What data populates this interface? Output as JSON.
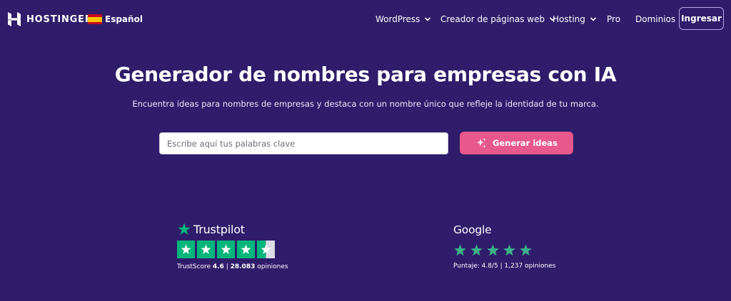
{
  "header": {
    "brand": "HOSTINGER",
    "language": "Español",
    "menu": [
      {
        "label": "WordPress",
        "has_dropdown": true
      },
      {
        "label": "Creador de páginas web",
        "has_dropdown": true
      },
      {
        "label": "Hosting",
        "has_dropdown": true
      },
      {
        "label": "Pro",
        "has_dropdown": false
      },
      {
        "label": "Dominios",
        "has_dropdown": false
      }
    ],
    "login_label": "Ingresar"
  },
  "hero": {
    "title": "Generador de nombres para empresas con IA",
    "subtitle": "Encuentra ideas para nombres de empresas y destaca con un nombre único que refleje la identidad de tu marca.",
    "search_placeholder": "Escribe aquí tus palabras clave",
    "search_value": "",
    "generate_label": "Generar ideas"
  },
  "reviews": {
    "trustpilot": {
      "brand": "Trustpilot",
      "rating_stars": 4.5,
      "score_label": "TrustScore",
      "score": "4.6",
      "separator": "|",
      "count": "28.083",
      "count_label": "opiniones"
    },
    "google": {
      "brand": "Google",
      "rating_stars": 5,
      "score_text": "Puntaje: 4.8/5 | 1,237 opiniones"
    }
  },
  "colors": {
    "background": "#2f1c6a",
    "accent_button": "#e8588a",
    "trustpilot_green": "#00b67a",
    "google_star_green": "#3bb38a"
  },
  "icons": {
    "logo": "hostinger-logo-icon",
    "flag": "spain-flag-icon",
    "dropdown": "chevron-down-icon",
    "generate": "sparkles-icon",
    "star": "star-icon"
  }
}
